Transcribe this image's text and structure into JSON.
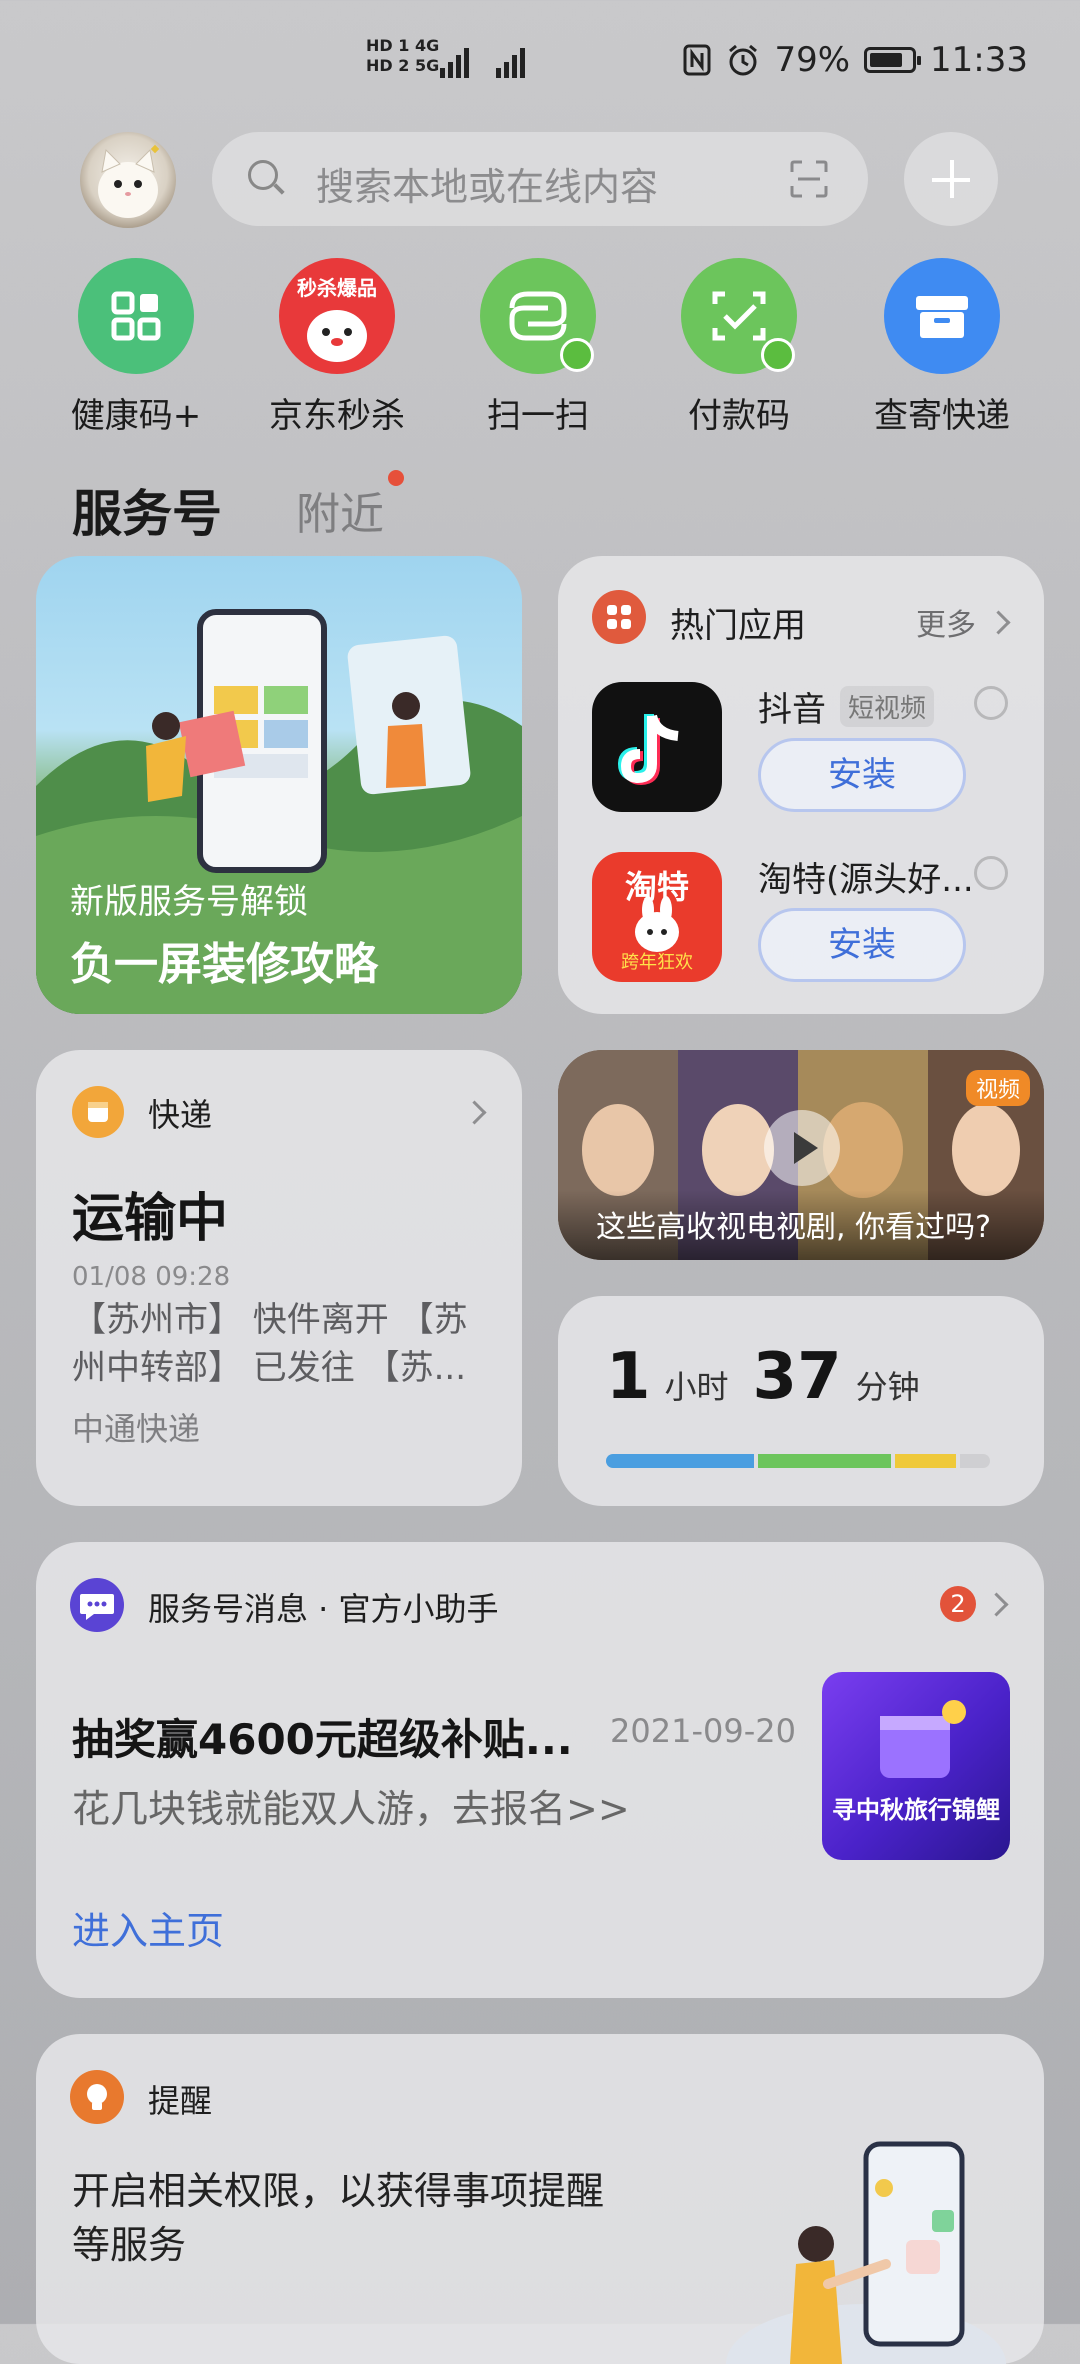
{
  "status_bar": {
    "net_top": "HD 1 4G",
    "net_bottom": "HD 2 5G",
    "battery": "79%",
    "battery_level": 0.79,
    "time": "11:33"
  },
  "search": {
    "placeholder": "搜索本地或在线内容"
  },
  "shortcuts": [
    {
      "label": "健康码+",
      "color": "#4bc07a"
    },
    {
      "label": "京东秒杀",
      "color": "#e8393a",
      "badge": "秒杀爆品"
    },
    {
      "label": "扫一扫",
      "color": "#6cc55c"
    },
    {
      "label": "付款码",
      "color": "#6cc55c"
    },
    {
      "label": "查寄快递",
      "color": "#3f8bf2"
    }
  ],
  "tabs": {
    "main": "服务号",
    "nearby": "附近"
  },
  "banner": {
    "line1": "新版服务号解锁",
    "line2": "负一屏装修攻略"
  },
  "hot_apps": {
    "title": "热门应用",
    "more": "更多",
    "apps": [
      {
        "name": "抖音",
        "tag": "短视频",
        "install": "安装"
      },
      {
        "name": "淘特(源头好...",
        "tag": "",
        "install": "安装",
        "icon_text": "淘特",
        "icon_sub": "跨年狂欢"
      }
    ]
  },
  "express": {
    "title": "快递",
    "status": "运输中",
    "time": "01/08 09:28",
    "detail": "【苏州市】 快件离开 【苏州中转部】 已发往 【苏...",
    "company": "中通快递"
  },
  "video": {
    "badge": "视频",
    "title": "这些高收视电视剧, 你看过吗?"
  },
  "screen_time": {
    "hours": "1",
    "hours_unit": "小时",
    "minutes": "37",
    "minutes_unit": "分钟",
    "segments": [
      {
        "color": "#4a9ee0",
        "fraction": 0.39
      },
      {
        "color": "#6cc55c",
        "fraction": 0.35
      },
      {
        "color": "#efc93a",
        "fraction": 0.16
      },
      {
        "color": "#cfcfd2",
        "fraction": 0.08
      }
    ]
  },
  "service_msg": {
    "title": "服务号消息 · 官方小助手",
    "count": "2",
    "headline": "抽奖赢4600元超级补贴...",
    "date": "2021-09-20",
    "sub": "花几块钱就能双人游，去报名>>",
    "image_text": "寻中秋旅行锦鲤",
    "link": "进入主页"
  },
  "reminder": {
    "title": "提醒",
    "text": "开启相关权限，以获得事项提醒等服务"
  }
}
